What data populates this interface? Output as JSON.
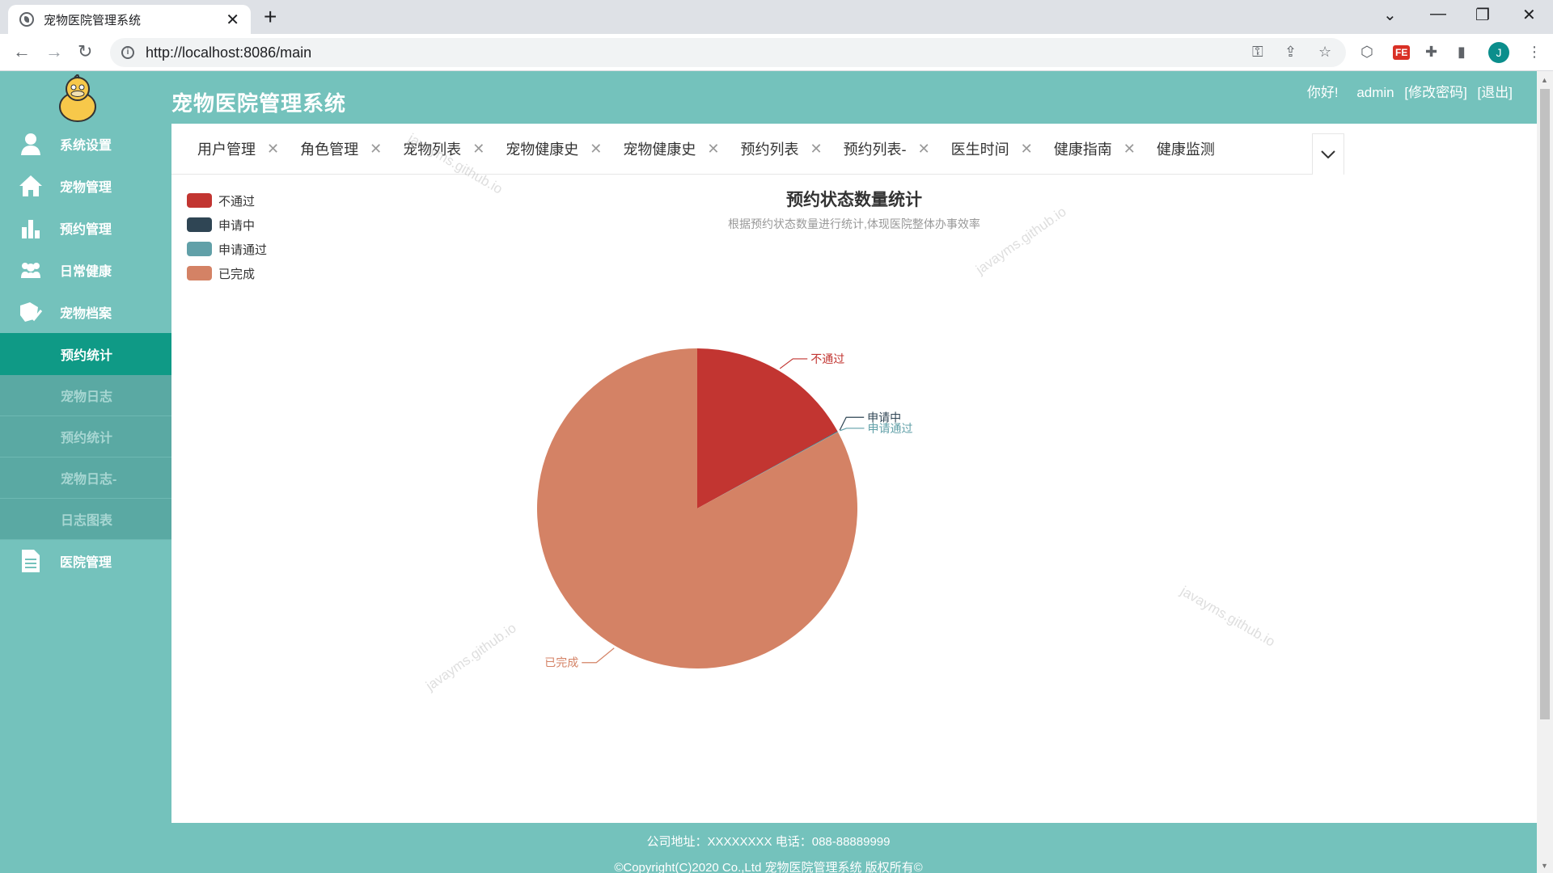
{
  "browser": {
    "tab_title": "宠物医院管理系统",
    "url": "http://localhost:8086/main",
    "profile_initial": "J"
  },
  "app": {
    "title": "宠物医院管理系统",
    "greeting": "你好!",
    "username": "admin",
    "change_password": "[修改密码]",
    "logout": "[退出]"
  },
  "sidebar": {
    "items": [
      {
        "label": "系统设置",
        "icon": "user-icon"
      },
      {
        "label": "宠物管理",
        "icon": "home-icon"
      },
      {
        "label": "预约管理",
        "icon": "bar-chart-icon"
      },
      {
        "label": "日常健康",
        "icon": "group-icon"
      },
      {
        "label": "宠物档案",
        "icon": "folder-check-icon"
      }
    ],
    "subitems": [
      {
        "label": "预约统计",
        "active": true
      },
      {
        "label": "宠物日志",
        "active": false
      },
      {
        "label": "预约统计",
        "active": false
      },
      {
        "label": "宠物日志-",
        "active": false
      },
      {
        "label": "日志图表",
        "active": false
      }
    ],
    "last_item": {
      "label": "医院管理",
      "icon": "document-icon"
    }
  },
  "tabs": [
    "用户管理",
    "角色管理",
    "宠物列表",
    "宠物健康史",
    "宠物健康史",
    "预约列表",
    "预约列表-",
    "医生时间",
    "健康指南",
    "健康监测"
  ],
  "watermark": "javayms.github.io",
  "chart_data": {
    "type": "pie",
    "title": "预约状态数量统计",
    "subtitle": "根据预约状态数量进行统计,体现医院整体办事效率",
    "legend_position": "top-left",
    "series": [
      {
        "name": "不通过",
        "value": 17,
        "color": "#c23531"
      },
      {
        "name": "申请中",
        "value": 0.05,
        "color": "#2f4554"
      },
      {
        "name": "申请通过",
        "value": 0.05,
        "color": "#61a0a8"
      },
      {
        "name": "已完成",
        "value": 83,
        "color": "#d48265"
      }
    ]
  },
  "footer": {
    "address": "公司地址：XXXXXXXX 电话：088-88889999",
    "copyright": "©Copyright(C)2020 Co.,Ltd 宠物医院管理系统 版权所有©"
  }
}
